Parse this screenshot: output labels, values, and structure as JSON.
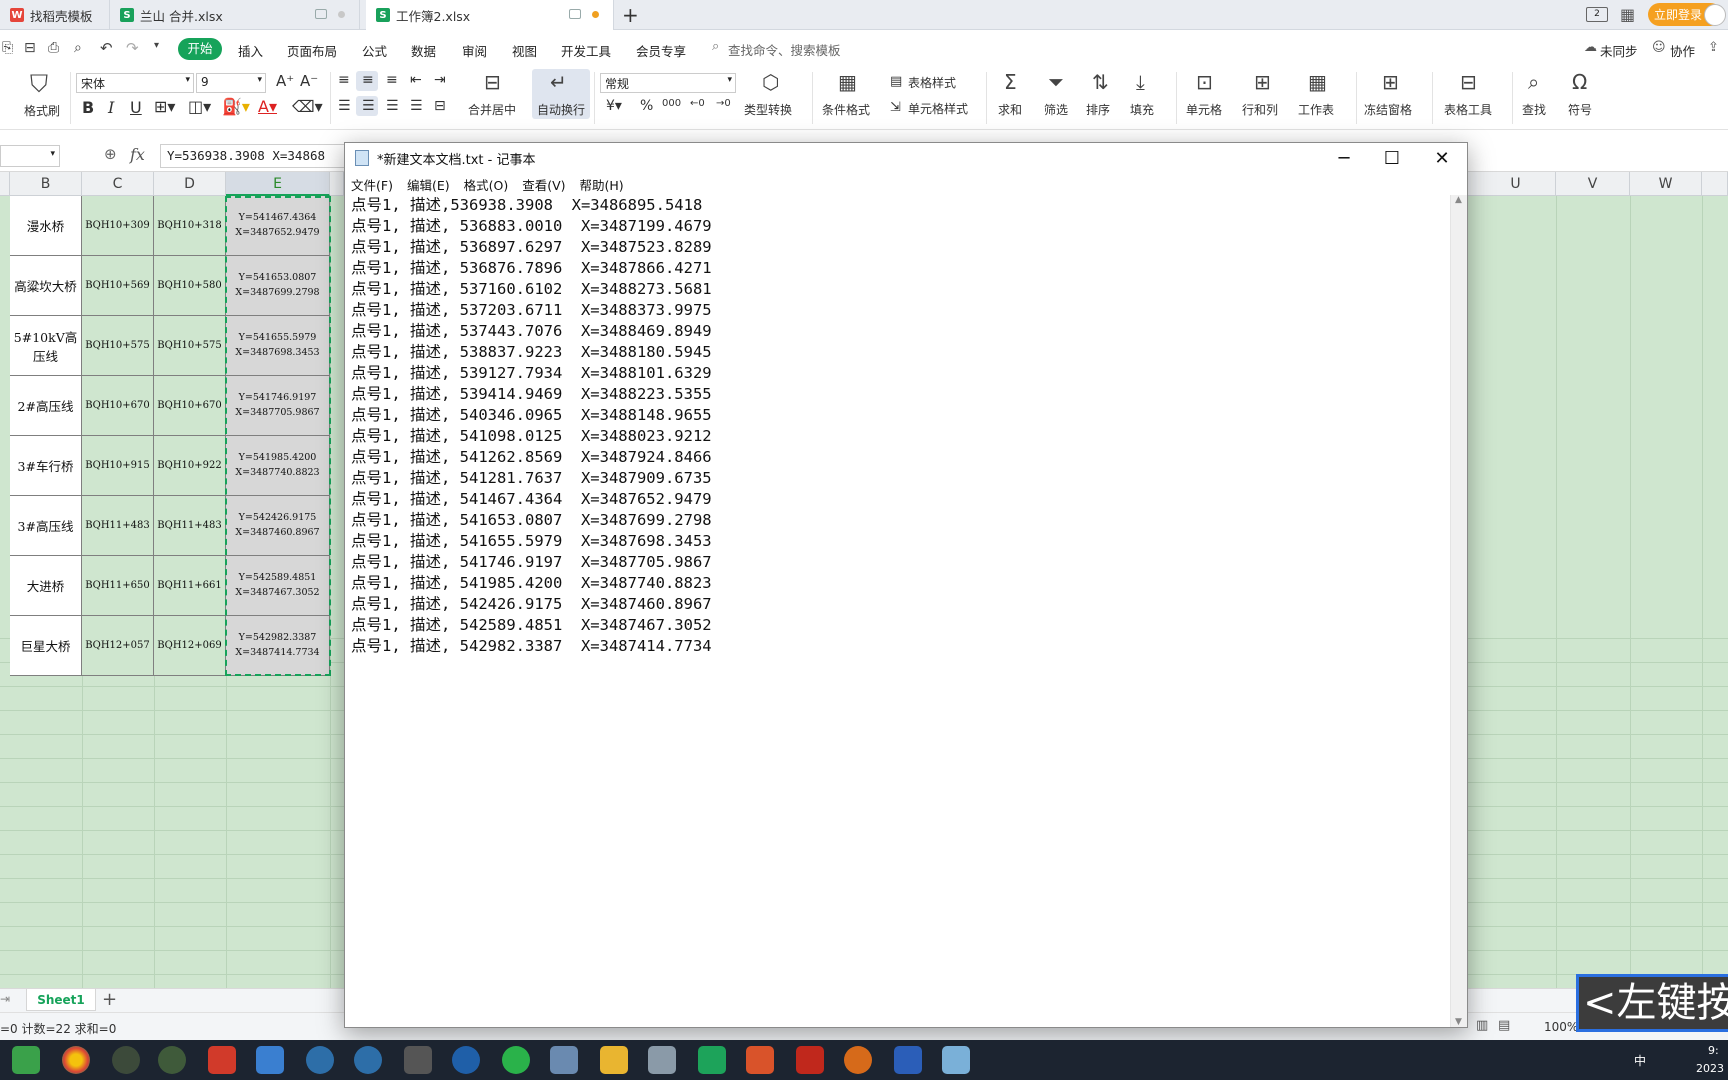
{
  "tabs": [
    {
      "label": "找稻壳模板",
      "active": false
    },
    {
      "label": "兰山  合并.xlsx",
      "active": false
    },
    {
      "label": "工作簿2.xlsx",
      "active": true
    }
  ],
  "login_label": "立即登录",
  "menu": {
    "start": "开始",
    "items": [
      "插入",
      "页面布局",
      "公式",
      "数据",
      "审阅",
      "视图",
      "开发工具",
      "会员专享"
    ],
    "search_placeholder": "查找命令、搜索模板",
    "right_items": [
      "未同步",
      "协作"
    ]
  },
  "ribbon": {
    "format_painter": "格式刷",
    "font_name": "宋体",
    "font_size": "9",
    "merge_center": "合并居中",
    "wrap_text": "自动换行",
    "number_format": "常规",
    "type_convert": "类型转换",
    "cond_format": "条件格式",
    "table_style": "表格样式",
    "cell_style": "单元格样式",
    "sum": "求和",
    "filter": "筛选",
    "sort": "排序",
    "fill": "填充",
    "cell": "单元格",
    "row_col": "行和列",
    "worksheet": "工作表",
    "freeze": "冻结窗格",
    "table_tools": "表格工具",
    "find": "查找",
    "symbol": "符号"
  },
  "formula_bar": {
    "fx": "fx",
    "content": "Y=536938.3908  X=34868"
  },
  "columns_left": [
    "B",
    "C",
    "D",
    "E"
  ],
  "columns_right": [
    "U",
    "V",
    "W"
  ],
  "rows": [
    {
      "name": "漫水桥",
      "c": "BQH10+309",
      "d": "BQH10+318",
      "y": "Y=541467.4364",
      "x": "X=3487652.9479"
    },
    {
      "name": "高粱坎大桥",
      "c": "BQH10+569",
      "d": "BQH10+580",
      "y": "Y=541653.0807",
      "x": "X=3487699.2798"
    },
    {
      "name": "5#10kV高压线",
      "c": "BQH10+575",
      "d": "BQH10+575",
      "y": "Y=541655.5979",
      "x": "X=3487698.3453"
    },
    {
      "name": "2#高压线",
      "c": "BQH10+670",
      "d": "BQH10+670",
      "y": "Y=541746.9197",
      "x": "X=3487705.9867"
    },
    {
      "name": "3#车行桥",
      "c": "BQH10+915",
      "d": "BQH10+922",
      "y": "Y=541985.4200",
      "x": "X=3487740.8823"
    },
    {
      "name": "3#高压线",
      "c": "BQH11+483",
      "d": "BQH11+483",
      "y": "Y=542426.9175",
      "x": "X=3487460.8967"
    },
    {
      "name": "大进桥",
      "c": "BQH11+650",
      "d": "BQH11+661",
      "y": "Y=542589.4851",
      "x": "X=3487467.3052"
    },
    {
      "name": "巨星大桥",
      "c": "BQH12+057",
      "d": "BQH12+069",
      "y": "Y=542982.3387",
      "x": "X=3487414.7734"
    }
  ],
  "sheet_tab": "Sheet1",
  "status": {
    "left": "=0  计数=22  求和=0",
    "zoom": "100%"
  },
  "notepad": {
    "title": "*新建文本文档.txt - 记事本",
    "menu": [
      "文件(F)",
      "编辑(E)",
      "格式(O)",
      "查看(V)",
      "帮助(H)"
    ],
    "lines": [
      "点号1, 描述,536938.3908  X=3486895.5418",
      "点号1, 描述, 536883.0010  X=3487199.4679",
      "点号1, 描述, 536897.6297  X=3487523.8289",
      "点号1, 描述, 536876.7896  X=3487866.4271",
      "点号1, 描述, 537160.6102  X=3488273.5681",
      "点号1, 描述, 537203.6711  X=3488373.9975",
      "点号1, 描述, 537443.7076  X=3488469.8949",
      "点号1, 描述, 538837.9223  X=3488180.5945",
      "点号1, 描述, 539127.7934  X=3488101.6329",
      "点号1, 描述, 539414.9469  X=3488223.5355",
      "点号1, 描述, 540346.0965  X=3488148.9655",
      "点号1, 描述, 541098.0125  X=3488023.9212",
      "点号1, 描述, 541262.8569  X=3487924.8466",
      "点号1, 描述, 541281.7637  X=3487909.6735",
      "点号1, 描述, 541467.4364  X=3487652.9479",
      "点号1, 描述, 541653.0807  X=3487699.2798",
      "点号1, 描述, 541655.5979  X=3487698.3453",
      "点号1, 描述, 541746.9197  X=3487705.9867",
      "点号1, 描述, 541985.4200  X=3487740.8823",
      "点号1, 描述, 542426.9175  X=3487460.8967",
      "点号1, 描述, 542589.4851  X=3487467.3052",
      "点号1, 描述, 542982.3387  X=3487414.7734"
    ]
  },
  "overlay_hint": "<左键按",
  "taskbar": {
    "ime": "中",
    "clock_time": "9:",
    "clock_date": "2023"
  }
}
